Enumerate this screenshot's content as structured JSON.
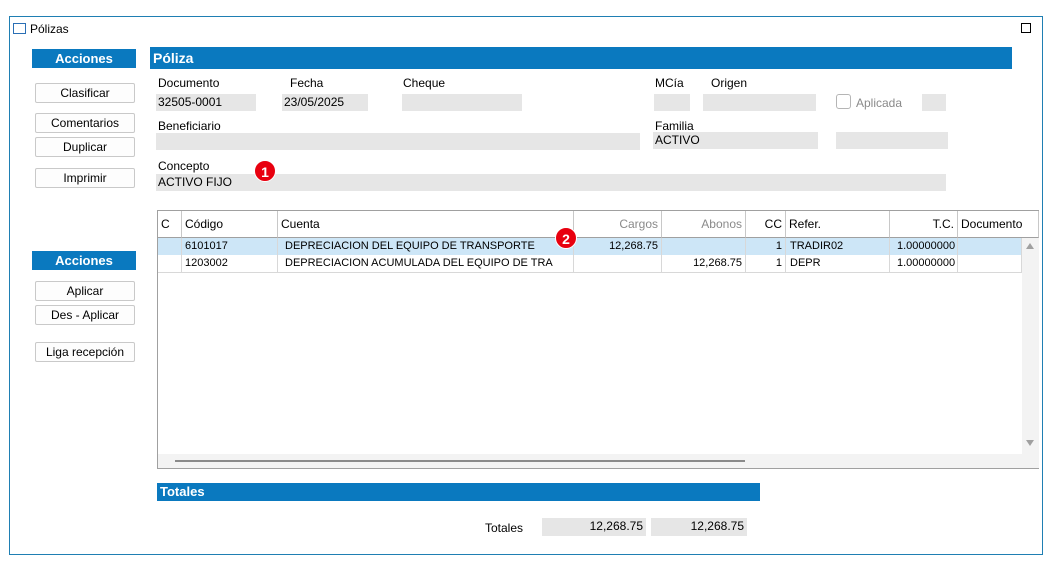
{
  "window": {
    "title": "Pólizas"
  },
  "actions1": {
    "header": "Acciones",
    "buttons": [
      "Clasificar",
      "Comentarios",
      "Duplicar",
      "Imprimir"
    ]
  },
  "actions2": {
    "header": "Acciones",
    "buttons": [
      "Aplicar",
      "Des - Aplicar",
      "Liga recepción"
    ]
  },
  "poliza": {
    "header": "Póliza",
    "documento_label": "Documento",
    "documento_value": "32505-0001",
    "fecha_label": "Fecha",
    "fecha_value": "23/05/2025",
    "cheque_label": "Cheque",
    "cheque_value": "",
    "mcia_label": "MCía",
    "mcia_value": "",
    "origen_label": "Origen",
    "origen_value": "",
    "aplicada_label": "Aplicada",
    "aplicada_checked": false,
    "beneficiario_label": "Beneficiario",
    "beneficiario_value": "",
    "familia_label": "Familia",
    "familia_value": "ACTIVO",
    "concepto_label": "Concepto",
    "concepto_value": "ACTIVO FIJO"
  },
  "badges": [
    "1",
    "2"
  ],
  "grid": {
    "columns": [
      "C",
      "Código",
      "Cuenta",
      "Cargos",
      "Abonos",
      "CC",
      "Refer.",
      "T.C.",
      "Documento"
    ],
    "rows": [
      {
        "c": "",
        "codigo": "6101017",
        "cuenta": "DEPRECIACION DEL EQUIPO DE TRANSPORTE",
        "cargos": "12,268.75",
        "abonos": "",
        "cc": "1",
        "refer": "TRADIR02",
        "tc": "1.00000000",
        "documento": ""
      },
      {
        "c": "",
        "codigo": "1203002",
        "cuenta": "DEPRECIACION ACUMULADA DEL EQUIPO DE TRA",
        "cargos": "",
        "abonos": "12,268.75",
        "cc": "1",
        "refer": "DEPR",
        "tc": "1.00000000",
        "documento": ""
      }
    ]
  },
  "totales": {
    "header": "Totales",
    "label": "Totales",
    "cargos": "12,268.75",
    "abonos": "12,268.75"
  },
  "icons": [
    "window-icon",
    "maximize-icon",
    "scroll-up-arrow-icon",
    "scroll-down-arrow-icon"
  ]
}
